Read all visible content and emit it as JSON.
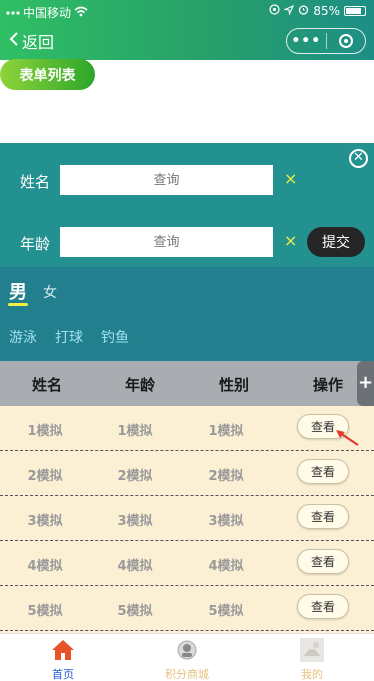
{
  "status_bar": {
    "carrier": "中国移动",
    "battery": "85%"
  },
  "nav": {
    "back_label": "返回"
  },
  "list_button": {
    "label": "表单列表"
  },
  "filter": {
    "name_label": "姓名",
    "name_placeholder": "查询",
    "age_label": "年龄",
    "age_placeholder": "查询",
    "clear_glyph": "×",
    "submit_label": "提交",
    "close_glyph": "✕"
  },
  "gender": {
    "selected": "男",
    "other": "女"
  },
  "hobbies": [
    "游泳",
    "打球",
    "钓鱼"
  ],
  "table": {
    "headers": [
      "姓名",
      "年龄",
      "性别",
      "操作"
    ],
    "add_glyph": "+",
    "rows": [
      {
        "name": "1模拟",
        "age": "1模拟",
        "gender": "1模拟",
        "action": "查看"
      },
      {
        "name": "2模拟",
        "age": "2模拟",
        "gender": "2模拟",
        "action": "查看"
      },
      {
        "name": "3模拟",
        "age": "3模拟",
        "gender": "3模拟",
        "action": "查看"
      },
      {
        "name": "4模拟",
        "age": "4模拟",
        "gender": "4模拟",
        "action": "查看"
      },
      {
        "name": "5模拟",
        "age": "5模拟",
        "gender": "5模拟",
        "action": "查看"
      }
    ]
  },
  "tabbar": [
    {
      "label": "首页",
      "icon": "home-icon",
      "color": "#1e5bd6"
    },
    {
      "label": "积分商城",
      "icon": "mall-avatar-icon",
      "color": "#e8c080"
    },
    {
      "label": "我的",
      "icon": "profile-avatar-icon",
      "color": "#e8c080"
    }
  ],
  "colors": {
    "nav_gradient_start": "#2fbf63",
    "filter_bg": "#23918f",
    "tag_bg": "#227f8d",
    "row_bg": "#fbf0d4",
    "accent_underline": "#f1ef42"
  }
}
